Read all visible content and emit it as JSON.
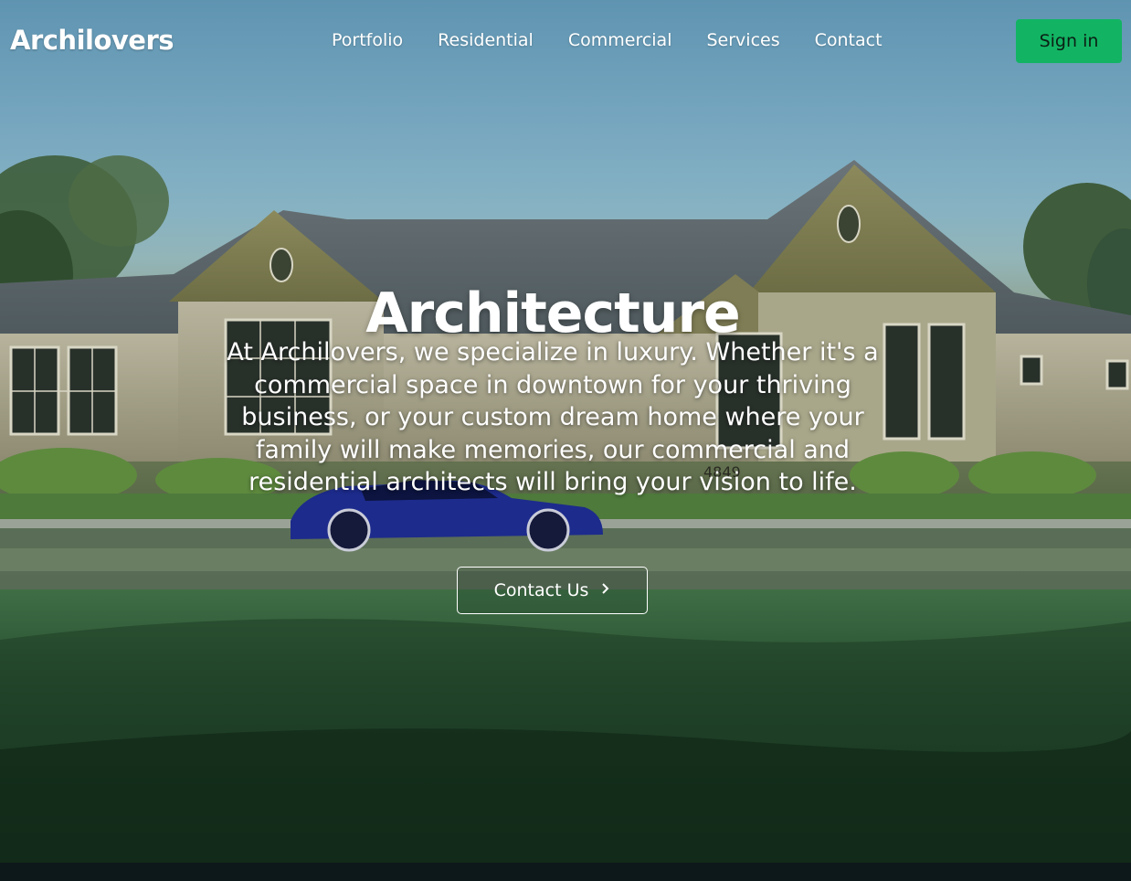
{
  "brand": {
    "name": "Archilovers"
  },
  "nav": {
    "links": [
      {
        "label": "Portfolio"
      },
      {
        "label": "Residential"
      },
      {
        "label": "Commercial"
      },
      {
        "label": "Services"
      },
      {
        "label": "Contact"
      }
    ],
    "signin_label": "Sign in"
  },
  "hero": {
    "title": "Architecture",
    "description": "At Archilovers, we specialize in luxury. Whether it's a commercial space in downtown for your thriving business, or your custom dream home where your family will make memories, our commercial and residential architects will bring your vision to life.",
    "cta_label": "Contact Us",
    "cta_icon": "chevron-right-icon",
    "house_number": "4849"
  },
  "colors": {
    "accent": "#12b463",
    "text": "#ffffff",
    "footer_strip": "#0d181b"
  }
}
